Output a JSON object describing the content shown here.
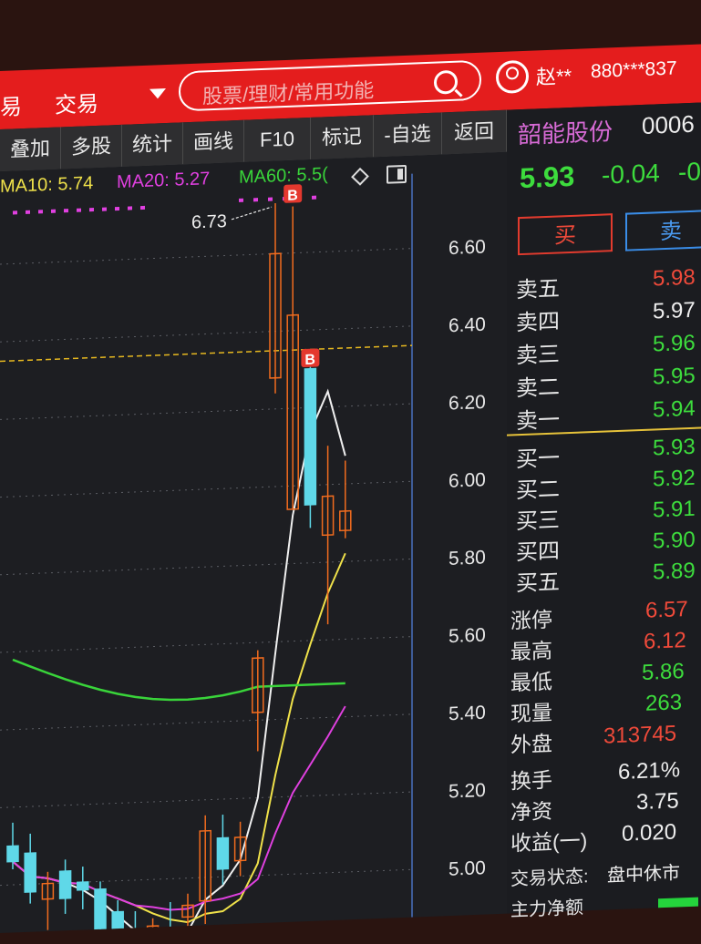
{
  "topbar": {
    "nav_partial": "易",
    "nav_trade": "交易",
    "search_placeholder": "股票/理财/常用功能",
    "user_name": "赵**",
    "account": "880***837"
  },
  "toolbar": [
    "叠加",
    "多股",
    "统计",
    "画线",
    "F10",
    "标记",
    "-自选",
    "返回"
  ],
  "chart": {
    "ma10": "MA10: 5.74",
    "ma20": "MA20: 5.27",
    "ma60": "MA60: 5.5(",
    "price_ticks": [
      {
        "label": "6.60",
        "v": 6.6
      },
      {
        "label": "6.40",
        "v": 6.4
      },
      {
        "label": "6.20",
        "v": 6.2
      },
      {
        "label": "6.00",
        "v": 6.0
      },
      {
        "label": "5.80",
        "v": 5.8
      },
      {
        "label": "5.60",
        "v": 5.6
      },
      {
        "label": "5.40",
        "v": 5.4
      },
      {
        "label": "5.20",
        "v": 5.2
      },
      {
        "label": "5.00",
        "v": 5.0
      }
    ],
    "high_annotation": "6.73",
    "buy_marker": "B",
    "ref_line": 6.35,
    "colors": {
      "up": "#f26c1e",
      "down": "#5fd8e8",
      "ma10": "#f0e24a",
      "ma20": "#e040e0",
      "ma60": "#39d43a",
      "ma5": "#f0f0f0"
    },
    "candles": [
      {
        "o": 5.1,
        "h": 5.16,
        "l": 5.04,
        "c": 5.06
      },
      {
        "o": 5.08,
        "h": 5.13,
        "l": 4.95,
        "c": 4.98
      },
      {
        "o": 4.96,
        "h": 5.03,
        "l": 4.88,
        "c": 5.0
      },
      {
        "o": 5.03,
        "h": 5.06,
        "l": 4.92,
        "c": 4.96
      },
      {
        "o": 5.0,
        "h": 5.04,
        "l": 4.93,
        "c": 4.98
      },
      {
        "o": 4.98,
        "h": 5.0,
        "l": 4.84,
        "c": 4.86
      },
      {
        "o": 4.92,
        "h": 4.95,
        "l": 4.8,
        "c": 4.84
      },
      {
        "o": 4.86,
        "h": 4.92,
        "l": 4.76,
        "c": 4.8
      },
      {
        "o": 4.82,
        "h": 4.9,
        "l": 4.78,
        "c": 4.88
      },
      {
        "o": 4.86,
        "h": 4.94,
        "l": 4.8,
        "c": 4.84
      },
      {
        "o": 4.9,
        "h": 4.96,
        "l": 4.86,
        "c": 4.93
      },
      {
        "o": 4.94,
        "h": 5.16,
        "l": 4.88,
        "c": 5.12
      },
      {
        "o": 5.1,
        "h": 5.16,
        "l": 4.98,
        "c": 5.02
      },
      {
        "o": 5.04,
        "h": 5.14,
        "l": 5.0,
        "c": 5.1
      },
      {
        "o": 5.42,
        "h": 5.58,
        "l": 5.32,
        "c": 5.56
      },
      {
        "o": 6.28,
        "h": 6.73,
        "l": 6.24,
        "c": 6.6
      },
      {
        "o": 5.94,
        "h": 6.72,
        "l": 5.94,
        "c": 6.44
      },
      {
        "o": 6.3,
        "h": 6.31,
        "l": 5.89,
        "c": 5.95
      },
      {
        "o": 5.87,
        "h": 6.1,
        "l": 5.64,
        "c": 5.97
      },
      {
        "o": 5.88,
        "h": 6.06,
        "l": 5.86,
        "c": 5.93
      }
    ]
  },
  "quote": {
    "name": "韶能股份",
    "code": "0006",
    "price": "5.93",
    "change": "-0.04",
    "change_pct": "-0",
    "buy_label": "买",
    "sell_label": "卖",
    "asks": [
      {
        "label": "卖五",
        "value": "5.98"
      },
      {
        "label": "卖四",
        "value": "5.97"
      },
      {
        "label": "卖三",
        "value": "5.96"
      },
      {
        "label": "卖二",
        "value": "5.95"
      },
      {
        "label": "卖一",
        "value": "5.94"
      }
    ],
    "bids": [
      {
        "label": "买一",
        "value": "5.93"
      },
      {
        "label": "买二",
        "value": "5.92"
      },
      {
        "label": "买三",
        "value": "5.91"
      },
      {
        "label": "买四",
        "value": "5.90"
      },
      {
        "label": "买五",
        "value": "5.89"
      }
    ],
    "stats": [
      {
        "label": "涨停",
        "value": "6.57"
      },
      {
        "label": "最高",
        "value": "6.12"
      },
      {
        "label": "最低",
        "value": "5.86"
      },
      {
        "label": "现量",
        "value": "263"
      },
      {
        "label": "外盘",
        "value": "313745"
      }
    ],
    "fundamentals": [
      {
        "label": "换手",
        "value": "6.21%"
      },
      {
        "label": "净资",
        "value": "3.75"
      },
      {
        "label": "收益(一)",
        "value": "0.020"
      }
    ],
    "trade_status_label": "交易状态:",
    "trade_status_value": "盘中休市",
    "net_flow_label": "主力净额"
  }
}
